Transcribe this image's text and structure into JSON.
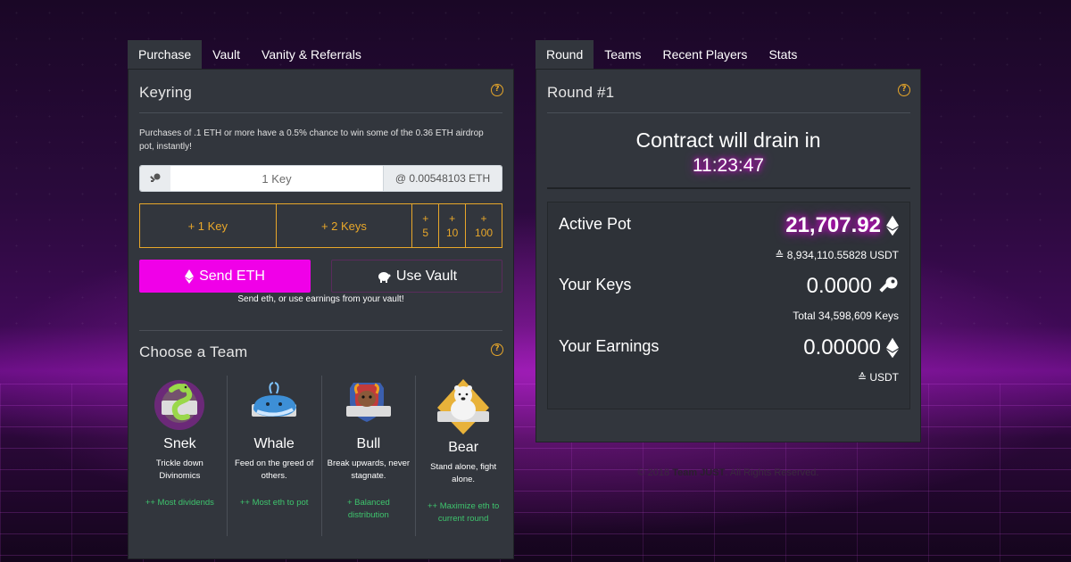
{
  "left_tabs": [
    "Purchase",
    "Vault",
    "Vanity & Referrals"
  ],
  "right_tabs": [
    "Round",
    "Teams",
    "Recent Players",
    "Stats"
  ],
  "purchase": {
    "title": "Keyring",
    "help": "?",
    "info": "Purchases of .1 ETH or more have a 0.5% chance to win some of the 0.36 ETH airdrop pot, instantly!",
    "key_input_value": "1 Key",
    "price": "@ 0.00548103 ETH",
    "buttons": {
      "add1": "+ 1 Key",
      "add2": "+ 2 Keys",
      "add5_plus": "+",
      "add5_num": "5",
      "add10_plus": "+",
      "add10_num": "10",
      "add100_plus": "+",
      "add100_num": "100"
    },
    "send_label": "Send ETH",
    "vault_label": "Use Vault",
    "send_hint": "Send eth, or use earnings from your vault!"
  },
  "team_section": {
    "title": "Choose a Team",
    "help": "?",
    "teams": [
      {
        "name": "Snek",
        "desc": "Trickle down Divinomics",
        "perk": "++ Most dividends"
      },
      {
        "name": "Whale",
        "desc": "Feed on the greed of others.",
        "perk": "++ Most eth to pot"
      },
      {
        "name": "Bull",
        "desc": "Break upwards, never stagnate.",
        "perk": "+ Balanced distribution"
      },
      {
        "name": "Bear",
        "desc": "Stand alone, fight alone.",
        "perk": "++ Maximize eth to current round"
      }
    ]
  },
  "round": {
    "title": "Round #1",
    "help": "?",
    "drain_text": "Contract will drain in",
    "timer": "11:23:47",
    "active_pot_label": "Active Pot",
    "active_pot_value": "21,707.92",
    "active_pot_usdt": "8,934,110.55828 USDT",
    "your_keys_label": "Your Keys",
    "your_keys_value": "0.0000",
    "total_keys": "Total 34,598,609 Keys",
    "your_earnings_label": "Your Earnings",
    "your_earnings_value": "0.00000",
    "earnings_usdt": "USDT"
  },
  "footer": {
    "prefix": "© 2018",
    "brand": "Team JUST",
    "suffix": ". All Rights Reserved."
  },
  "colors": {
    "accent_magenta": "#f000e8",
    "accent_orange": "#e8a72a",
    "perk_green": "#3ec46d",
    "panel_bg": "#32363d"
  }
}
